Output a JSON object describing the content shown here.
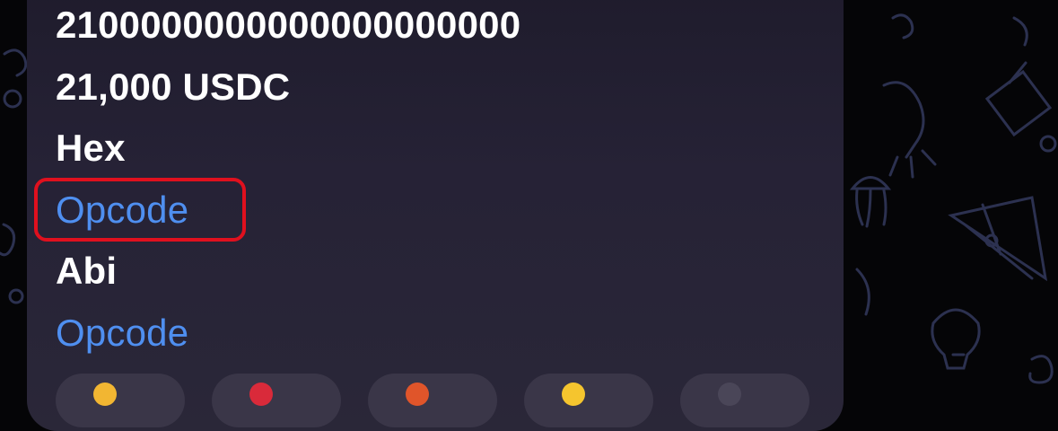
{
  "message": {
    "lines": [
      {
        "text": "2100000000000000000000",
        "style": "bold"
      },
      {
        "text": "21,000 USDC",
        "style": "bold"
      },
      {
        "text": "Hex",
        "style": "bold"
      },
      {
        "text": "Opcode",
        "style": "link"
      },
      {
        "text": "Abi",
        "style": "bold"
      },
      {
        "text": "Opcode",
        "style": "link"
      }
    ],
    "highlighted_line": "Opcode"
  },
  "reactions": [
    {
      "icon": "thumbs-up-icon"
    },
    {
      "icon": "heart-icon"
    },
    {
      "icon": "fire-icon"
    },
    {
      "icon": "smile-icon"
    },
    {
      "icon": "more-reactions-icon"
    }
  ],
  "colors": {
    "background": "#050507",
    "bubble": "#262236",
    "text": "#ffffff",
    "link": "#4f8ff0",
    "highlight": "#e0101e"
  }
}
